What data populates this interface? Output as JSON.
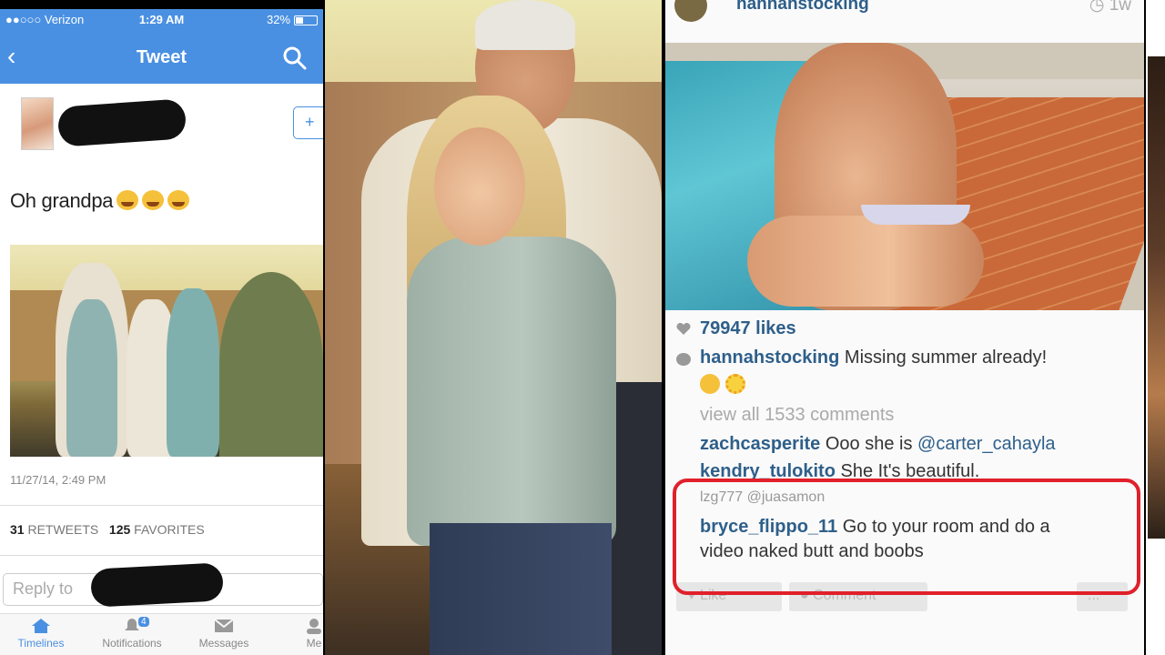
{
  "twitter": {
    "status": {
      "carrier": "●●○○○ Verizon",
      "time": "1:29 AM",
      "battery": "32%"
    },
    "nav_title": "Tweet",
    "tweet_text": "Oh grandpa",
    "timestamp": "11/27/14, 2:49 PM",
    "retweets": "31",
    "retweets_label": "RETWEETS",
    "favorites": "125",
    "favorites_label": "FAVORITES",
    "reply_placeholder": "Reply to",
    "tabs": [
      {
        "label": "Timelines",
        "active": true
      },
      {
        "label": "Notifications",
        "badge": "4"
      },
      {
        "label": "Messages"
      },
      {
        "label": "Me"
      }
    ]
  },
  "instagram": {
    "username": "hannahstocking",
    "time": "1w",
    "likes": "79947 likes",
    "caption_user": "hannahstocking",
    "caption": "Missing summer already!",
    "view_all": "view all 1533 comments",
    "comments": [
      {
        "user": "zachcasperite",
        "text": "Ooo she is ",
        "mention": "@carter_cahayla"
      },
      {
        "user": "kendry_tulokito",
        "text": "She It's beautiful."
      },
      {
        "user": "lzg777",
        "text": "@juasamon"
      },
      {
        "user": "bryce_flippo_11",
        "text": "Go to your room and do a",
        "text2": "video naked butt and boobs"
      }
    ],
    "actions": [
      "Like",
      "Comment",
      "..."
    ]
  },
  "colors": {
    "twitter_blue": "#4a90e2",
    "instagram_link": "#2e5f8a",
    "highlight_red": "#e0202a"
  }
}
